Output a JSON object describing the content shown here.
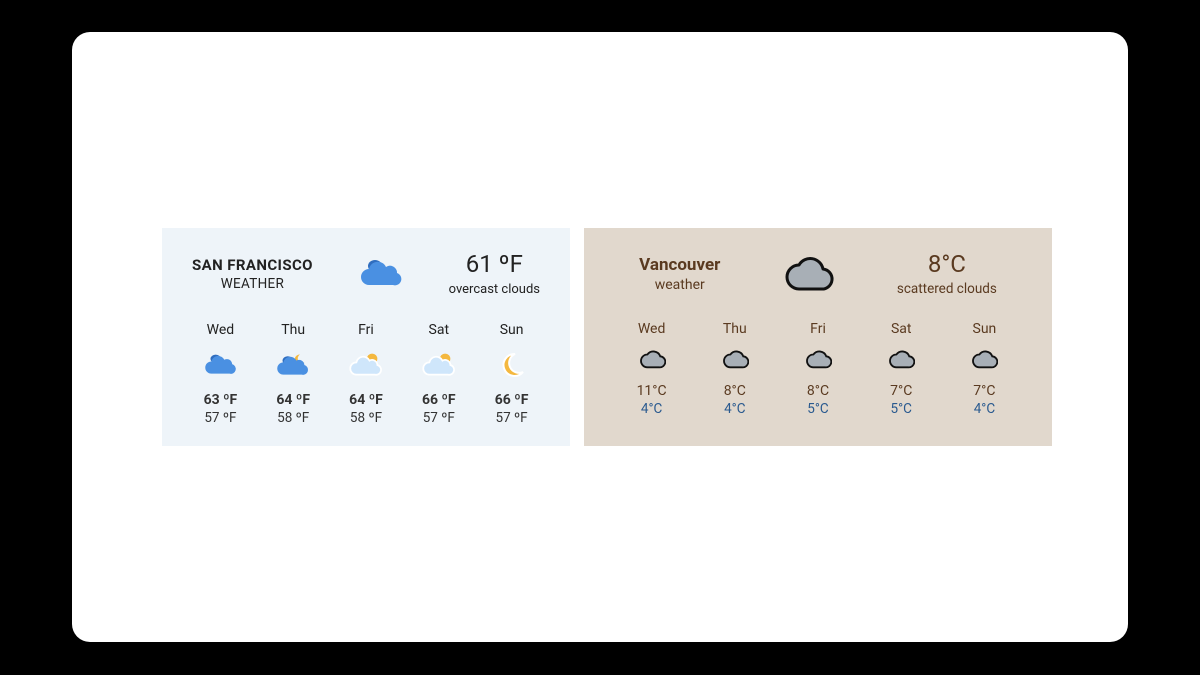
{
  "sf": {
    "city": "SAN FRANCISCO",
    "subtitle": "WEATHER",
    "current_temp": "61 ºF",
    "current_cond": "overcast clouds",
    "days": [
      {
        "day": "Wed",
        "hi": "63 ºF",
        "lo": "57 ºF",
        "icon": "sf-cloud-blue"
      },
      {
        "day": "Thu",
        "hi": "64 ºF",
        "lo": "58 ºF",
        "icon": "sf-cloud-blue-moon"
      },
      {
        "day": "Fri",
        "hi": "64 ºF",
        "lo": "58 ºF",
        "icon": "sf-cloud-light-sun"
      },
      {
        "day": "Sat",
        "hi": "66 ºF",
        "lo": "57 ºF",
        "icon": "sf-cloud-light-sun"
      },
      {
        "day": "Sun",
        "hi": "66 ºF",
        "lo": "57 ºF",
        "icon": "sf-moon"
      }
    ]
  },
  "vc": {
    "city": "Vancouver",
    "subtitle": "weather",
    "current_temp": "8°C",
    "current_cond": "scattered clouds",
    "days": [
      {
        "day": "Wed",
        "hi": "11°C",
        "lo": "4°C",
        "icon": "vc-cloud"
      },
      {
        "day": "Thu",
        "hi": "8°C",
        "lo": "4°C",
        "icon": "vc-cloud"
      },
      {
        "day": "Fri",
        "hi": "8°C",
        "lo": "5°C",
        "icon": "vc-cloud"
      },
      {
        "day": "Sat",
        "hi": "7°C",
        "lo": "5°C",
        "icon": "vc-cloud"
      },
      {
        "day": "Sun",
        "hi": "7°C",
        "lo": "4°C",
        "icon": "vc-cloud"
      }
    ]
  }
}
